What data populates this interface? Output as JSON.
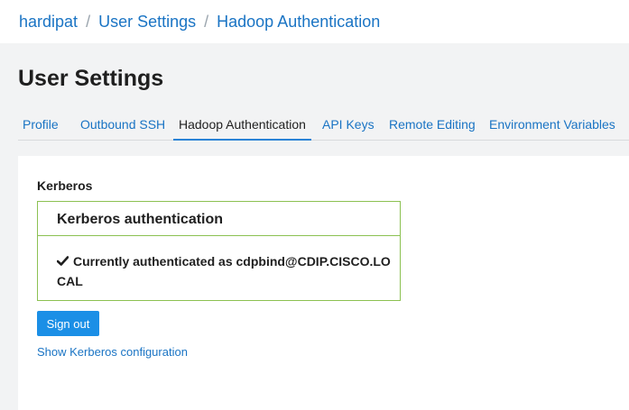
{
  "breadcrumb": {
    "user": "hardipat",
    "separator": "/",
    "section": "User Settings",
    "current": "Hadoop Authentication"
  },
  "page": {
    "title": "User Settings"
  },
  "tabs": [
    {
      "label": "Profile",
      "active": false
    },
    {
      "label": "Outbound SSH",
      "active": false
    },
    {
      "label": "Hadoop Authentication",
      "active": true
    },
    {
      "label": "API Keys",
      "active": false
    },
    {
      "label": "Remote Editing",
      "active": false
    },
    {
      "label": "Environment Variables",
      "active": false
    }
  ],
  "kerberos": {
    "section_label": "Kerberos",
    "panel_title": "Kerberos authentication",
    "status_icon": "check-icon",
    "status_prefix": "Currently authenticated as",
    "principal": "cdpbind@CDIP.CISCO.LOCAL",
    "sign_out_label": "Sign out",
    "show_config_label": "Show Kerberos configuration"
  },
  "colors": {
    "link": "#1a74c4",
    "panel_border": "#8cc152",
    "primary_button": "#1b8fe6",
    "page_background": "#f2f3f4"
  }
}
